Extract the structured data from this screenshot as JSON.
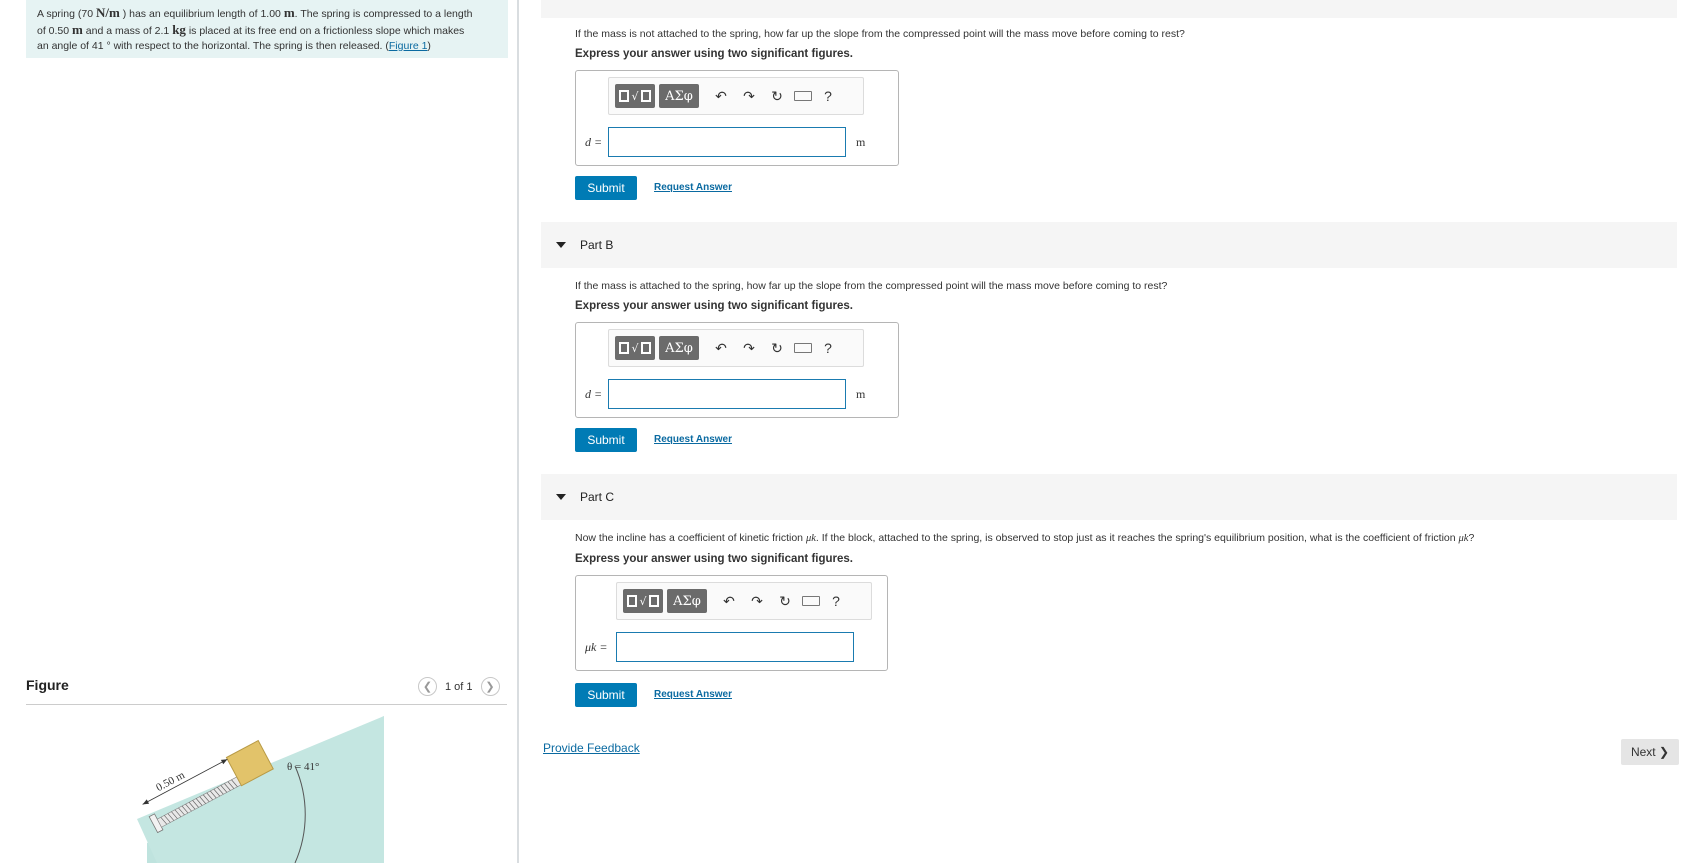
{
  "problem": {
    "line1_pre": "A spring (70 ",
    "line1_unit": "N/m",
    "line1_post": " ) has an equilibrium length of 1.00 ",
    "line1_m": "m",
    "line1_end": ". The spring is compressed to a length",
    "line2_pre": "of 0.50 ",
    "line2_m": "m",
    "line2_mid": " and a mass of 2.1 ",
    "line2_kg": "kg",
    "line2_end": " is placed at its free end on a frictionless slope which makes",
    "line3": "an angle of 41 ° with respect to the horizontal. The spring is then released. (",
    "figure_link": "Figure 1",
    "line3_end": ")"
  },
  "figure": {
    "title": "Figure",
    "pager": "1 of 1",
    "length_label": "0.50 m",
    "angle_label": "θ = 41°"
  },
  "partA": {
    "question": "If the mass is not attached to the spring, how far up the slope from the compressed point will the mass move before coming to rest?",
    "instruction": "Express your answer using two significant figures.",
    "var": "d =",
    "unit": "m",
    "submit": "Submit",
    "request": "Request Answer"
  },
  "partB": {
    "header": "Part B",
    "question": "If the mass is attached to the spring, how far up the slope from the compressed point will the mass move before coming to rest?",
    "instruction": "Express your answer using two significant figures.",
    "var": "d =",
    "unit": "m",
    "submit": "Submit",
    "request": "Request Answer"
  },
  "partC": {
    "header": "Part C",
    "question_pre": "Now the incline has a coefficient of kinetic friction ",
    "mu": "μk",
    "question_mid": ". If the block, attached to the spring, is observed to stop just as it reaches the spring's equilibrium position, what is the coefficient of friction ",
    "question_end": "?",
    "instruction": "Express your answer using two significant figures.",
    "var": "μk =",
    "submit": "Submit",
    "request": "Request Answer"
  },
  "toolbar": {
    "greek": "ΑΣφ",
    "undo": "↶",
    "redo": "↷",
    "reset": "↻",
    "help": "?"
  },
  "footer": {
    "feedback": "Provide Feedback",
    "next": "Next ❯"
  },
  "colors": {
    "accent": "#007bb5",
    "link": "#0a6aa1",
    "problem_bg": "#e6f3f3",
    "slope": "#bfe3de",
    "block": "#e2c36a"
  }
}
